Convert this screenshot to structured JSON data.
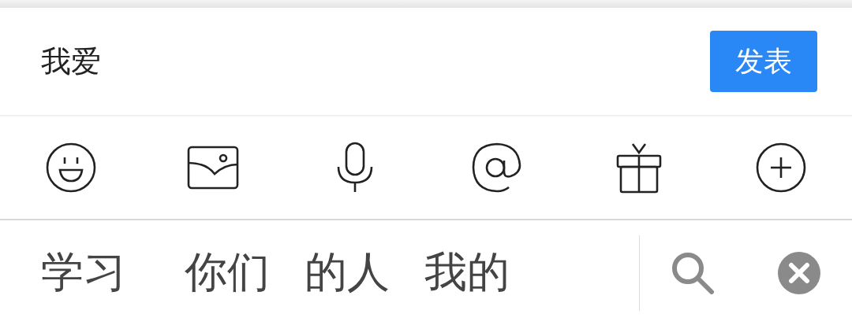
{
  "comment_input": {
    "value": "我爱"
  },
  "submit_button": {
    "label": "发表"
  },
  "toolbar": [
    {
      "kind": "emoji"
    },
    {
      "kind": "image"
    },
    {
      "kind": "voice"
    },
    {
      "kind": "mention"
    },
    {
      "kind": "gift"
    },
    {
      "kind": "more"
    }
  ],
  "suggestions": [
    "学习",
    "你们",
    "的人",
    "我的"
  ]
}
